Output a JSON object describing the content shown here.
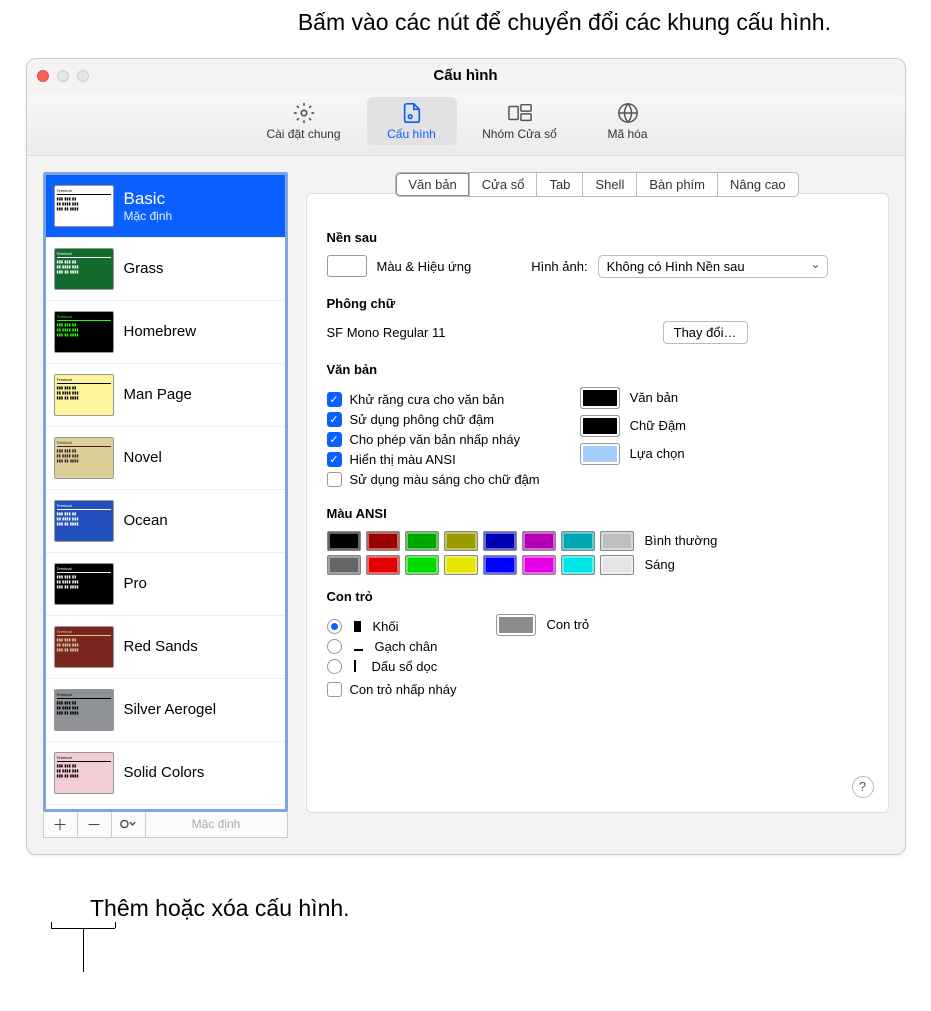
{
  "annotations": {
    "top": "Bấm vào các nút để chuyển đổi các khung cấu hình.",
    "bottom": "Thêm hoặc xóa cấu hình."
  },
  "window": {
    "title": "Cấu hình"
  },
  "toolbar": {
    "general": "Cài đặt chung",
    "profiles": "Cấu hình",
    "window_groups": "Nhóm Cửa sổ",
    "encodings": "Mã hóa"
  },
  "sidebar": {
    "profiles": [
      {
        "name": "Basic",
        "subtitle": "Mặc định",
        "selected": true,
        "bg": "#ffffff",
        "fg": "#000"
      },
      {
        "name": "Grass",
        "bg": "#146b2e",
        "fg": "#fff"
      },
      {
        "name": "Homebrew",
        "bg": "#000000",
        "fg": "#28fe14"
      },
      {
        "name": "Man Page",
        "bg": "#fef49c",
        "fg": "#000"
      },
      {
        "name": "Novel",
        "bg": "#dccf9a",
        "fg": "#3b2322"
      },
      {
        "name": "Ocean",
        "bg": "#224fbc",
        "fg": "#fff"
      },
      {
        "name": "Pro",
        "bg": "#000000",
        "fg": "#f2f2f2"
      },
      {
        "name": "Red Sands",
        "bg": "#7a251e",
        "fg": "#d7c9a7"
      },
      {
        "name": "Silver Aerogel",
        "bg": "#8e9196",
        "fg": "#000"
      },
      {
        "name": "Solid Colors",
        "bg": "#f3cdd4",
        "fg": "#000"
      }
    ],
    "footer": {
      "default_label": "Mặc định"
    }
  },
  "tabs": {
    "text": "Văn bản",
    "window": "Cửa sổ",
    "tab": "Tab",
    "shell": "Shell",
    "keyboard": "Bàn phím",
    "advanced": "Nâng cao"
  },
  "panel": {
    "background": {
      "title": "Nền sau",
      "color_effects": "Màu & Hiệu ứng",
      "image_label": "Hình ảnh:",
      "image_value": "Không có Hình Nền sau"
    },
    "font": {
      "title": "Phông chữ",
      "value": "SF Mono Regular 11",
      "change": "Thay đổi…"
    },
    "text": {
      "title": "Văn bản",
      "antialias": "Khử răng cưa cho văn bản",
      "bold_fonts": "Sử dụng phông chữ đậm",
      "blink": "Cho phép văn bản nhấp nháy",
      "ansi": "Hiển thị màu ANSI",
      "bright_bold": "Sử dụng màu sáng cho chữ đậm",
      "text_color_label": "Văn bản",
      "bold_color_label": "Chữ Đậm",
      "selection_label": "Lựa chọn"
    },
    "ansi": {
      "title": "Màu ANSI",
      "normal": "Bình thường",
      "bright": "Sáng",
      "normal_colors": [
        "#000000",
        "#990000",
        "#00a600",
        "#999900",
        "#0000b2",
        "#b200b2",
        "#00a6b2",
        "#bfbfbf"
      ],
      "bright_colors": [
        "#666666",
        "#e50000",
        "#00d900",
        "#e5e500",
        "#0000ff",
        "#e500e5",
        "#00e5e5",
        "#e5e5e5"
      ]
    },
    "cursor": {
      "title": "Con trỏ",
      "block": "Khối",
      "underline": "Gạch chân",
      "vbar": "Dấu sổ dọc",
      "blink_cursor": "Con trỏ nhấp nháy",
      "cursor_color_label": "Con trỏ"
    }
  }
}
